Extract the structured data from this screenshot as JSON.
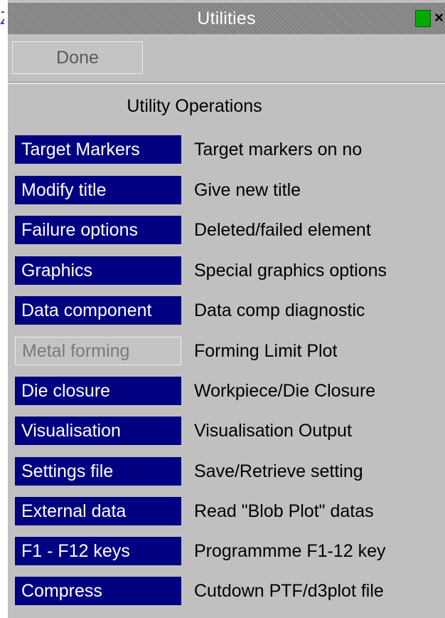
{
  "window": {
    "title": "Utilities",
    "close_label": "×",
    "accent_color": "#00aa00"
  },
  "done_label": "Done",
  "section_title": "Utility Operations",
  "operations": [
    {
      "label": "Target Markers",
      "description": "Target markers on no",
      "enabled": true
    },
    {
      "label": "Modify title",
      "description": "Give new title",
      "enabled": true
    },
    {
      "label": "Failure options",
      "description": "Deleted/failed element",
      "enabled": true
    },
    {
      "label": "Graphics",
      "description": "Special graphics options",
      "enabled": true
    },
    {
      "label": "Data component",
      "description": "Data comp diagnostic",
      "enabled": true
    },
    {
      "label": "Metal forming",
      "description": "Forming Limit Plot",
      "enabled": false
    },
    {
      "label": "Die closure",
      "description": "Workpiece/Die Closure",
      "enabled": true
    },
    {
      "label": "Visualisation",
      "description": "Visualisation Output",
      "enabled": true
    },
    {
      "label": "Settings file",
      "description": "Save/Retrieve setting",
      "enabled": true
    },
    {
      "label": "External data",
      "description": "Read \"Blob Plot\" datas",
      "enabled": true
    },
    {
      "label": "F1 - F12 keys",
      "description": "Programmme F1-12 key",
      "enabled": true
    },
    {
      "label": "Compress",
      "description": "Cutdown PTF/d3plot file",
      "enabled": true
    }
  ]
}
